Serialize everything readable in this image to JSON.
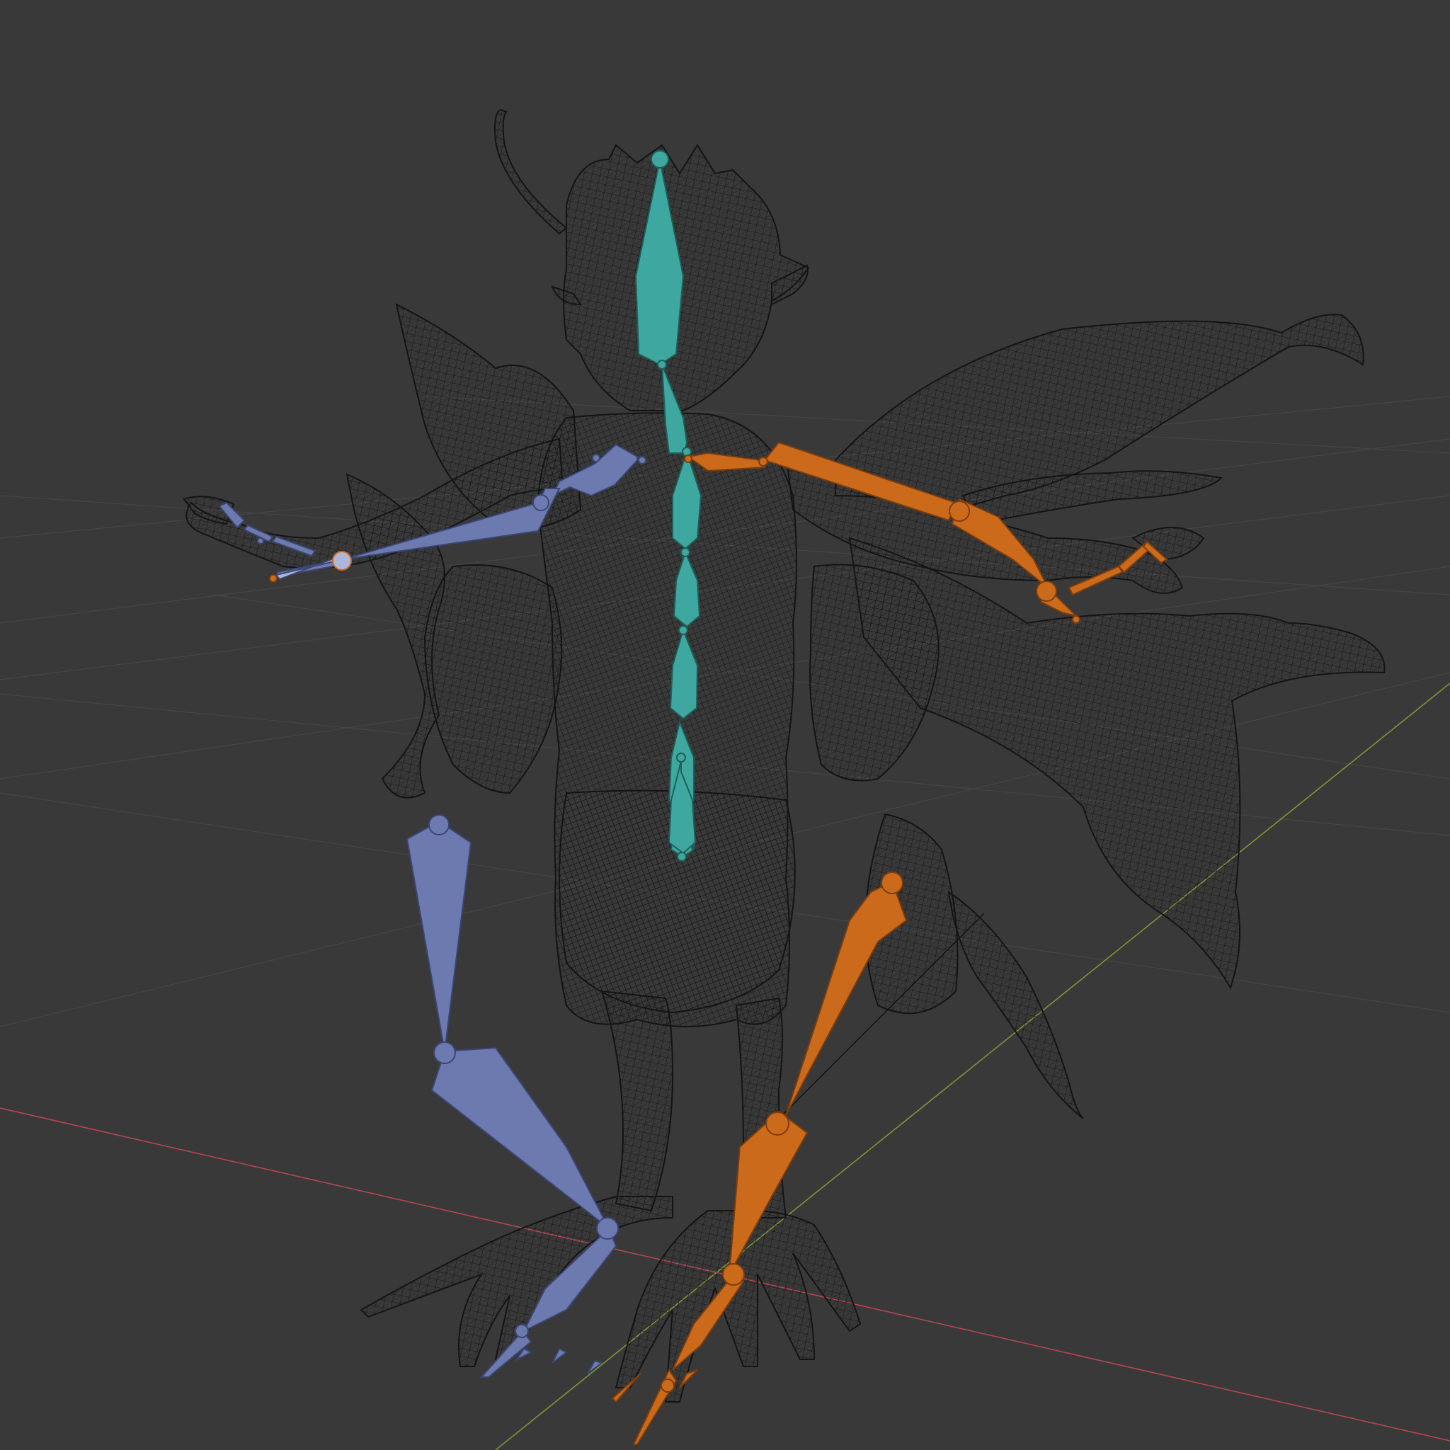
{
  "app": "3D viewport",
  "view": {
    "shading": "wireframe",
    "grid": true,
    "axes": [
      "x-axis",
      "y-axis"
    ]
  },
  "colors": {
    "background": "#393939",
    "grid_line": "#4a4a4a",
    "x_axis": "#b5464f",
    "y_axis": "#7e9635",
    "wire": "#151515",
    "bone_spine": "#3ea79f",
    "bone_left": "#6c7ab0",
    "bone_right": "#cc6a1c",
    "bone_active": "#aeb7d9"
  },
  "scene": {
    "object": "armature",
    "mesh": "creature"
  }
}
